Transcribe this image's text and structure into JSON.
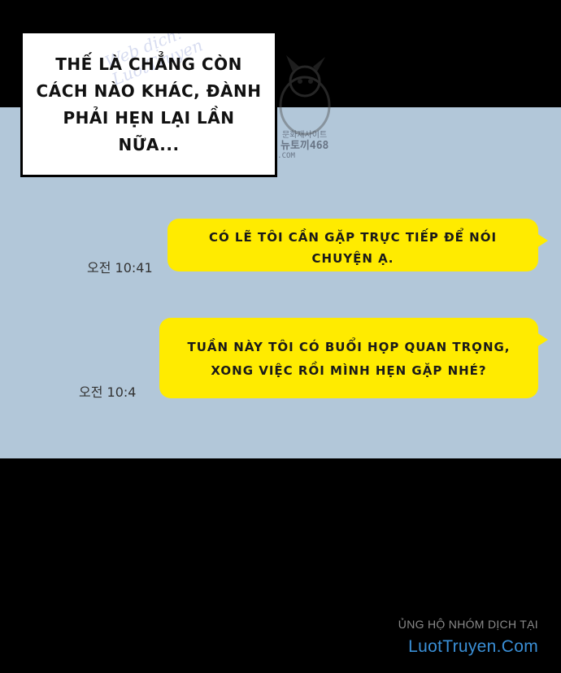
{
  "narration": {
    "lines": [
      "THẾ LÀ CHẲNG CÒN",
      "CÁCH NÀO KHÁC, ĐÀNH",
      "PHẢI HẸN LẠI LẦN",
      "NỮA..."
    ]
  },
  "scan_watermark": {
    "lines": [
      "Web dịch:",
      "LuotTruyen"
    ],
    "mascot_lines": [
      "문화재사이트",
      "뉴토끼468",
      "NEWTOKI468.COM"
    ]
  },
  "messages": [
    {
      "lines": [
        "CÓ LẼ TÔI CẦN GẶP TRỰC TIẾP ĐỂ NÓI",
        "CHUYỆN Ạ."
      ],
      "time": "오전 10:41"
    },
    {
      "lines": [
        "TUẦN NÀY TÔI CÓ BUỔI HỌP QUAN TRỌNG,",
        "XONG VIỆC RỒI MÌNH HẸN GẶP NHÉ?"
      ],
      "time": "오전 10:4"
    }
  ],
  "credit": {
    "line": "ỦNG HỘ NHÓM DỊCH TẠI",
    "site": "LuotTruyen.Com"
  },
  "colors": {
    "background": "#000000",
    "chat_background": "#b2c7d9",
    "bubble": "#ffeb00",
    "site_link": "#3a8fd6"
  }
}
